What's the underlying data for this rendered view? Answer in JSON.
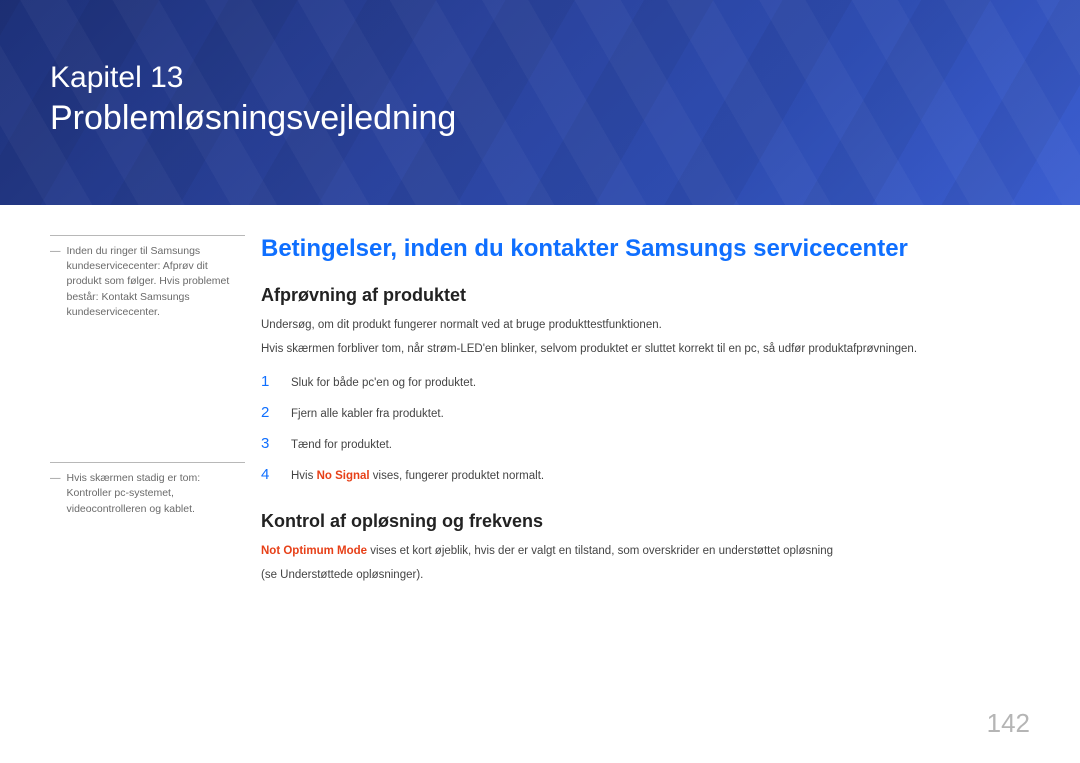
{
  "banner": {
    "chapter": "Kapitel 13",
    "title": "Problemløsningsvejledning"
  },
  "sidebar": {
    "note1": "Inden du ringer til Samsungs kundeservicecenter: Afprøv dit produkt som følger. Hvis problemet består: Kontakt Samsungs kundeservicecenter.",
    "note2": "Hvis skærmen stadig er tom: Kontroller pc-systemet, videocontrolleren og kablet."
  },
  "main": {
    "section_title": "Betingelser, inden du kontakter Samsungs servicecenter",
    "sub1_title": "Afprøvning af produktet",
    "sub1_p1": "Undersøg, om dit produkt fungerer normalt ved at bruge produkttestfunktionen.",
    "sub1_p2": "Hvis skærmen forbliver tom, når strøm-LED'en blinker, selvom produktet er sluttet korrekt til en pc, så udfør produktafprøvningen.",
    "steps": {
      "s1": {
        "n": "1",
        "t": "Sluk for både pc'en og for produktet."
      },
      "s2": {
        "n": "2",
        "t": "Fjern alle kabler fra produktet."
      },
      "s3": {
        "n": "3",
        "t": "Tænd for produktet."
      },
      "s4": {
        "n": "4",
        "prefix": "Hvis ",
        "bold": "No Signal",
        "suffix": " vises, fungerer produktet normalt."
      }
    },
    "sub2_title": "Kontrol af opløsning og frekvens",
    "sub2_bold": "Not Optimum Mode",
    "sub2_rest": " vises et kort øjeblik, hvis der er valgt en tilstand, som overskrider en understøttet opløsning",
    "sub2_p2": "(se Understøttede opløsninger)."
  },
  "page_number": "142"
}
